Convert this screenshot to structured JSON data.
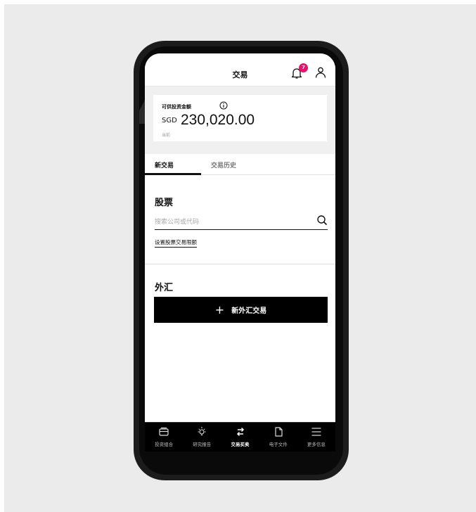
{
  "header": {
    "title": "交易",
    "notification_count": "7"
  },
  "balance": {
    "label": "可供投资金额",
    "currency": "SGD",
    "amount": "230,020.00",
    "subtext": "当前"
  },
  "tabs": [
    {
      "label": "新交易",
      "active": true
    },
    {
      "label": "交易历史",
      "active": false
    }
  ],
  "stocks": {
    "title": "股票",
    "search_placeholder": "搜索公司或代码",
    "limit_link": "设置股票交易限额"
  },
  "fx": {
    "title": "外汇",
    "button_label": "新外汇交易"
  },
  "bottom_nav": [
    {
      "label": "投资组合",
      "icon": "wallet-icon"
    },
    {
      "label": "研究报告",
      "icon": "lightbulb-icon"
    },
    {
      "label": "交易买卖",
      "icon": "swap-arrows-icon",
      "active": true
    },
    {
      "label": "电子文件",
      "icon": "document-icon"
    },
    {
      "label": "更多信息",
      "icon": "menu-icon"
    }
  ],
  "colors": {
    "badge": "#e2156b",
    "accent": "#000000",
    "background": "#ebebeb"
  }
}
